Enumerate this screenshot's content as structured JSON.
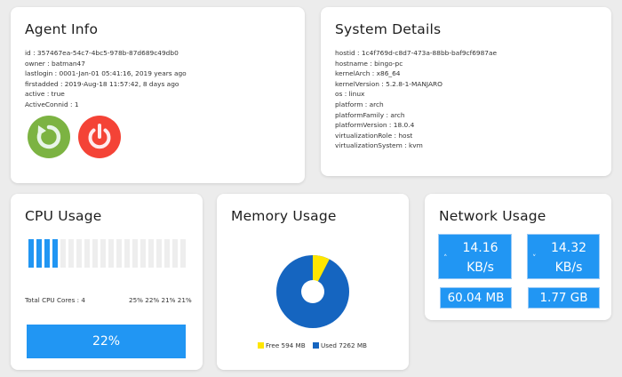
{
  "agent_info": {
    "title": "Agent Info",
    "lines": [
      "id : 357467ea-54c7-4bc5-978b-87d689c49db0",
      "owner : batman47",
      "lastlogin : 0001-Jan-01 05:41:16, 2019 years ago",
      "firstadded : 2019-Aug-18 11:57:42, 8 days ago",
      "active : true",
      "ActiveConnid : 1"
    ],
    "restart_icon": "restart-icon",
    "power_icon": "power-icon",
    "colors": {
      "restart": "#7cb342",
      "power": "#f44336"
    }
  },
  "system_details": {
    "title": "System Details",
    "lines": [
      "hostid : 1c4f769d-c8d7-473a-88bb-baf9cf6987ae",
      "hostname : bingo-pc",
      "kernelArch : x86_64",
      "kernelVersion : 5.2.8-1-MANJARO",
      "os : linux",
      "platform : arch",
      "platformFamily : arch",
      "platformVersion : 18.0.4",
      "virtualizationRole : host",
      "virtualizationSystem : kvm"
    ]
  },
  "cpu_usage": {
    "title": "CPU Usage",
    "total_cores_label": "Total CPU Cores : 4",
    "per_core": "25% 22% 21% 21%",
    "usage_label": "22%",
    "usage_fraction": 0.22,
    "bar_count": 20,
    "colors": {
      "active": "#2196f3",
      "inactive": "#eeeeee"
    }
  },
  "memory_usage": {
    "title": "Memory Usage",
    "free_label": "Free 594 MB",
    "used_label": "Used 7262 MB",
    "free_mb": 594,
    "used_mb": 7262,
    "colors": {
      "free": "#ffe600",
      "used": "#1565c0"
    }
  },
  "network_usage": {
    "title": "Network Usage",
    "upload_rate": {
      "value": "14.16",
      "unit": "KB/s",
      "icon": "chevron-up-icon"
    },
    "download_rate": {
      "value": "14.32",
      "unit": "KB/s",
      "icon": "chevron-down-icon"
    },
    "total_sent": "60.04 MB",
    "total_received": "1.77 GB",
    "color": "#2196f3"
  }
}
